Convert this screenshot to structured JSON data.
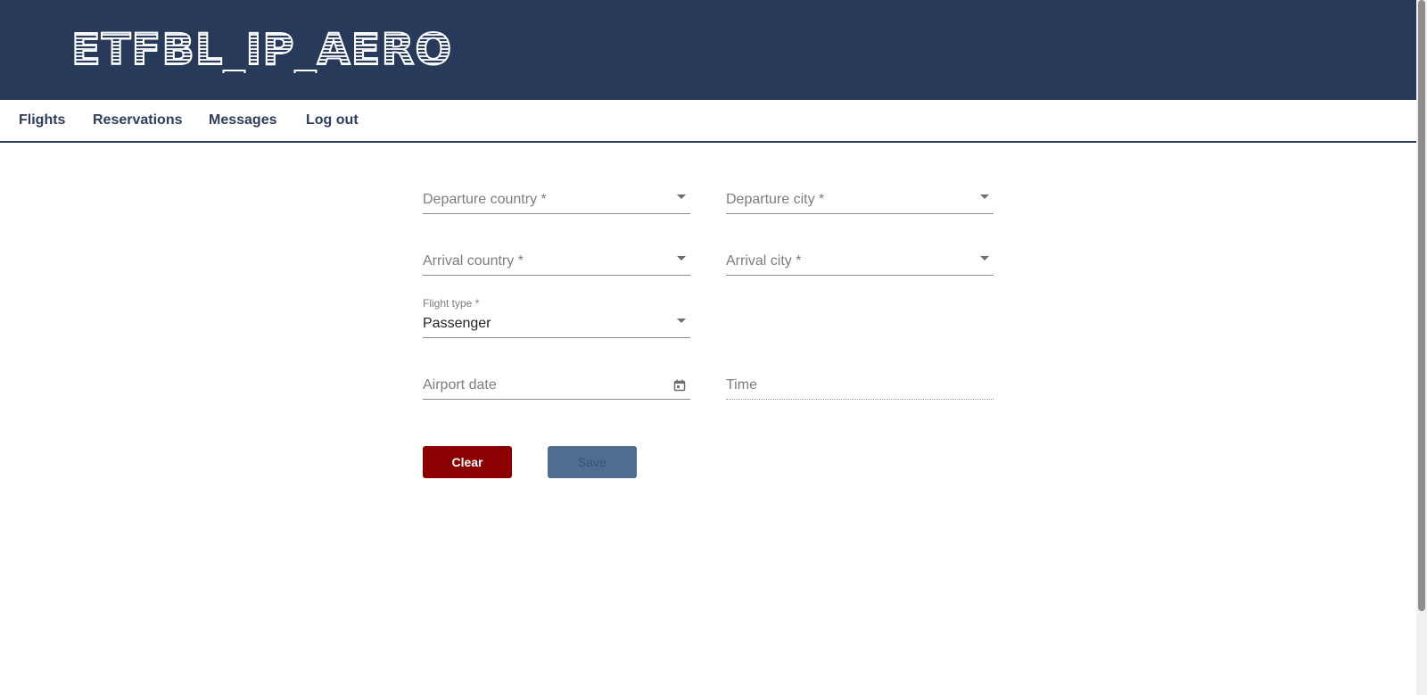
{
  "header": {
    "logo_text": "ETFBL_IP_AERO"
  },
  "nav": {
    "items": [
      {
        "label": "Flights"
      },
      {
        "label": "Reservations"
      },
      {
        "label": "Messages"
      },
      {
        "label": "Log out"
      }
    ]
  },
  "form": {
    "departure_country": {
      "placeholder": "Departure country *",
      "value": ""
    },
    "departure_city": {
      "placeholder": "Departure city *",
      "value": ""
    },
    "arrival_country": {
      "placeholder": "Arrival country *",
      "value": ""
    },
    "arrival_city": {
      "placeholder": "Arrival city *",
      "value": ""
    },
    "flight_type": {
      "label": "Flight type *",
      "value": "Passenger"
    },
    "airport_date": {
      "placeholder": "Airport date",
      "value": ""
    },
    "time": {
      "placeholder": "Time",
      "value": ""
    },
    "clear_label": "Clear",
    "save_label": "Save",
    "save_disabled": true
  },
  "colors": {
    "header_bg": "#273a5a",
    "nav_text": "#2c3e5c",
    "clear_bg": "#8b0000",
    "save_bg": "#4f6d8f"
  },
  "icons": {
    "dropdown": "chevron-down-icon",
    "calendar": "calendar-icon"
  }
}
